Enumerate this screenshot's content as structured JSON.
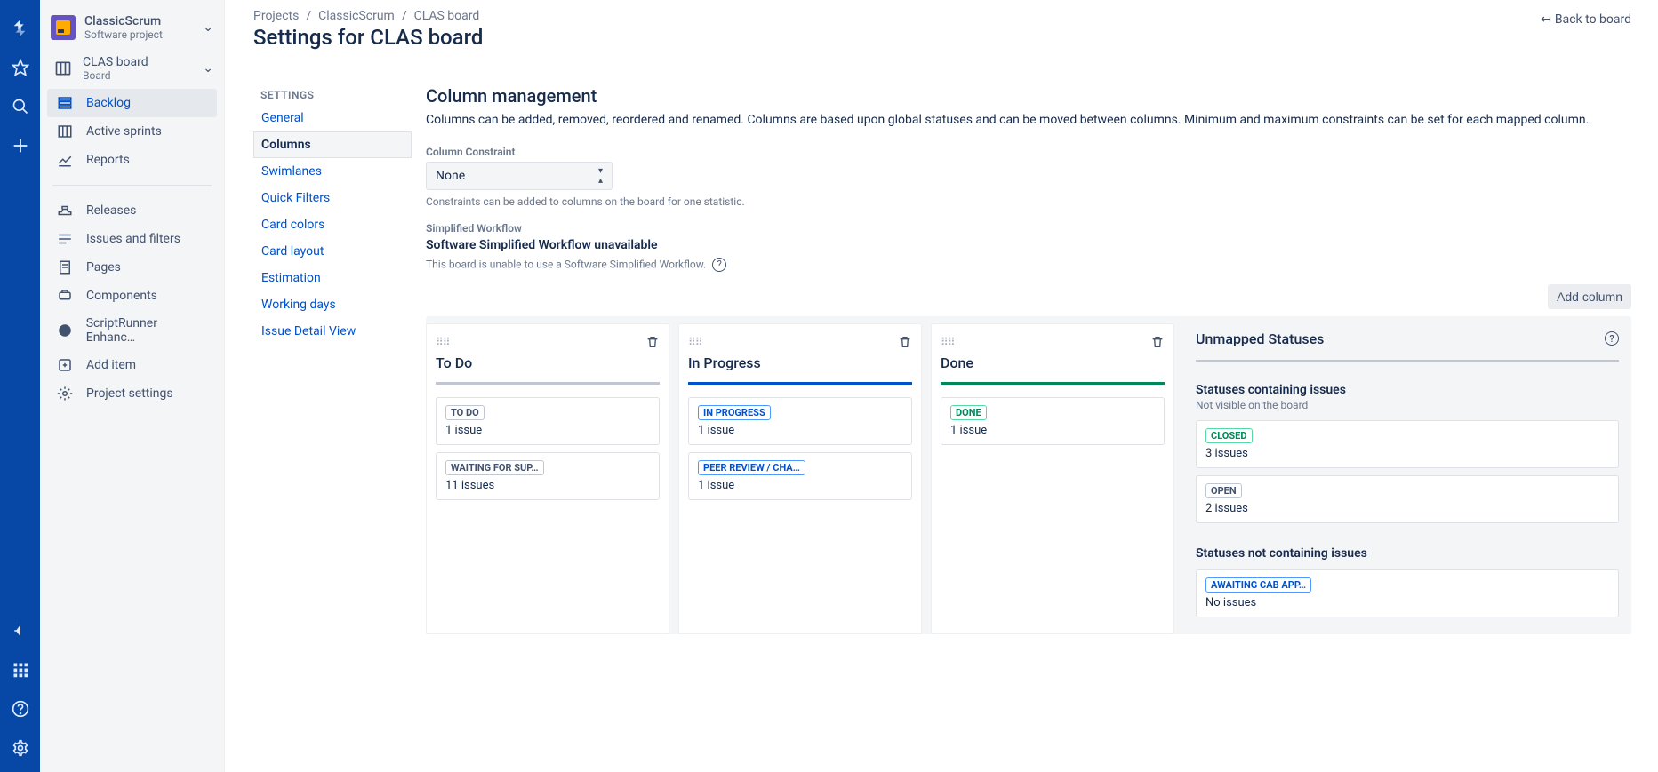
{
  "sidebar": {
    "project_name": "ClassicScrum",
    "project_type": "Software project",
    "board_name": "CLAS board",
    "board_sub": "Board",
    "nav1": [
      {
        "label": "Backlog"
      },
      {
        "label": "Active sprints"
      },
      {
        "label": "Reports"
      }
    ],
    "nav2": [
      {
        "label": "Releases"
      },
      {
        "label": "Issues and filters"
      },
      {
        "label": "Pages"
      },
      {
        "label": "Components"
      },
      {
        "label": "ScriptRunner Enhanc…"
      },
      {
        "label": "Add item"
      },
      {
        "label": "Project settings"
      }
    ]
  },
  "breadcrumb": {
    "c1": "Projects",
    "c2": "ClassicScrum",
    "c3": "CLAS board"
  },
  "page_title": "Settings for CLAS board",
  "back_link": "Back to board",
  "settings_nav": {
    "title": "SETTINGS",
    "items": [
      "General",
      "Columns",
      "Swimlanes",
      "Quick Filters",
      "Card colors",
      "Card layout",
      "Estimation",
      "Working days",
      "Issue Detail View"
    ]
  },
  "section": {
    "title": "Column management",
    "desc": "Columns can be added, removed, reordered and renamed. Columns are based upon global statuses and can be moved between columns. Minimum and maximum constraints can be set for each mapped column.",
    "constraint_label": "Column Constraint",
    "constraint_value": "None",
    "constraint_help": "Constraints can be added to columns on the board for one statistic.",
    "workflow_label": "Simplified Workflow",
    "workflow_status": "Software Simplified Workflow unavailable",
    "workflow_help": "This board is unable to use a Software Simplified Workflow.",
    "add_column": "Add column"
  },
  "columns": [
    {
      "title": "To Do",
      "bar": "gray",
      "statuses": [
        {
          "name": "TO DO",
          "loz": "gray",
          "count": "1 issue"
        },
        {
          "name": "WAITING FOR SUP…",
          "loz": "gray",
          "count": "11 issues"
        }
      ]
    },
    {
      "title": "In Progress",
      "bar": "blue",
      "statuses": [
        {
          "name": "IN PROGRESS",
          "loz": "blue",
          "count": "1 issue"
        },
        {
          "name": "PEER REVIEW / CHA…",
          "loz": "blue",
          "count": "1 issue"
        }
      ]
    },
    {
      "title": "Done",
      "bar": "green",
      "statuses": [
        {
          "name": "DONE",
          "loz": "green",
          "count": "1 issue"
        }
      ]
    }
  ],
  "unmapped": {
    "title": "Unmapped Statuses",
    "section1_title": "Statuses containing issues",
    "section1_note": "Not visible on the board",
    "section1_statuses": [
      {
        "name": "CLOSED",
        "loz": "green",
        "count": "3 issues"
      },
      {
        "name": "OPEN",
        "loz": "gray",
        "count": "2 issues"
      }
    ],
    "section2_title": "Statuses not containing issues",
    "section2_statuses": [
      {
        "name": "AWAITING CAB APP…",
        "loz": "blue",
        "count": "No issues"
      }
    ]
  }
}
